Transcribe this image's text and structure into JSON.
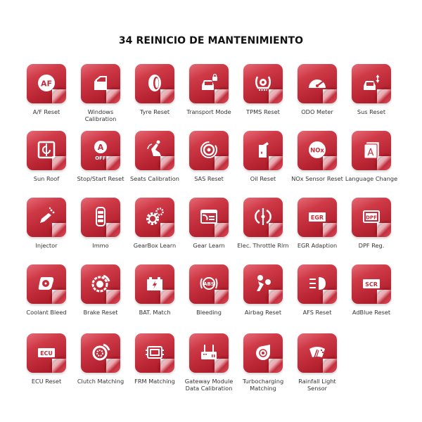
{
  "title": "34 REINICIO DE MANTENIMIENTO",
  "colors": {
    "tile_red": "#c42d3b",
    "glyph": "#ffffff",
    "label_text": "#333333",
    "title_text": "#111111"
  },
  "functions": [
    {
      "label": "A/F Reset",
      "icon": "af-icon"
    },
    {
      "label": "Windows Calibration",
      "icon": "car-door-window-icon"
    },
    {
      "label": "Tyre Reset",
      "icon": "tyre-icon"
    },
    {
      "label": "Transport Mode",
      "icon": "car-lock-icon"
    },
    {
      "label": "TPMS Reset",
      "icon": "tpms-icon"
    },
    {
      "label": "ODO Meter",
      "icon": "speedometer-icon"
    },
    {
      "label": "Sus Reset",
      "icon": "car-suspension-icon"
    },
    {
      "label": "Sun Roof",
      "icon": "sunroof-icon"
    },
    {
      "label": "Stop/Start Reset",
      "icon": "auto-stop-off-icon"
    },
    {
      "label": "Seats Calibration",
      "icon": "seat-icon"
    },
    {
      "label": "SAS Reset",
      "icon": "steering-angle-icon"
    },
    {
      "label": "Oil Reset",
      "icon": "oil-can-icon"
    },
    {
      "label": "NOx Sensor Reset",
      "icon": "nox-icon"
    },
    {
      "label": "Language Change",
      "icon": "language-icon"
    },
    {
      "label": "Injector",
      "icon": "injector-icon"
    },
    {
      "label": "Immo",
      "icon": "key-fob-icon"
    },
    {
      "label": "GearBox Learn",
      "icon": "gears-icon"
    },
    {
      "label": "Gear Learn",
      "icon": "gear-window-icon"
    },
    {
      "label": "Elec. Throttle Rlrn",
      "icon": "throttle-icon"
    },
    {
      "label": "EGR Adaption",
      "icon": "egr-icon"
    },
    {
      "label": "DPF Reg.",
      "icon": "dpf-icon"
    },
    {
      "label": "Coolant Bleed",
      "icon": "coolant-fan-icon"
    },
    {
      "label": "Brake Reset",
      "icon": "brake-disc-icon"
    },
    {
      "label": "BAT. Match",
      "icon": "battery-icon"
    },
    {
      "label": "Bleeding",
      "icon": "abs-icon"
    },
    {
      "label": "Airbag Reset",
      "icon": "airbag-icon"
    },
    {
      "label": "AFS Reset",
      "icon": "headlight-icon"
    },
    {
      "label": "AdBlue Reset",
      "icon": "scr-icon"
    },
    {
      "label": "ECU Reset",
      "icon": "ecu-icon"
    },
    {
      "label": "Clutch Matching",
      "icon": "clutch-icon"
    },
    {
      "label": "FRM Matching",
      "icon": "frm-module-icon"
    },
    {
      "label": "Gateway Module Data Calibration",
      "icon": "gateway-router-icon"
    },
    {
      "label": "Turbocharging Matching",
      "icon": "turbo-icon"
    },
    {
      "label": "Rainfall Light Sensor",
      "icon": "wiper-rain-icon"
    }
  ]
}
